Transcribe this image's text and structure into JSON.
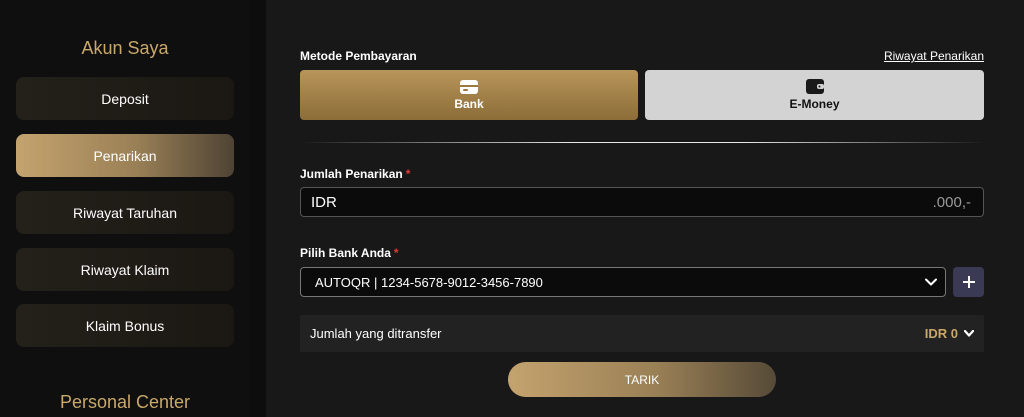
{
  "sidebar": {
    "title": "Akun Saya",
    "items": [
      {
        "label": "Deposit"
      },
      {
        "label": "Penarikan"
      },
      {
        "label": "Riwayat Taruhan"
      },
      {
        "label": "Riwayat Klaim"
      },
      {
        "label": "Klaim Bonus"
      }
    ],
    "section2_title": "Personal Center"
  },
  "form": {
    "method_label": "Metode Pembayaran",
    "history_link": "Riwayat Penarikan",
    "methods": [
      {
        "label": "Bank",
        "icon": "bank-card-icon"
      },
      {
        "label": "E-Money",
        "icon": "wallet-icon"
      }
    ],
    "amount_label": "Jumlah Penarikan",
    "required_mark": "*",
    "amount_currency": "IDR",
    "amount_suffix": ".000,-",
    "bank_label": "Pilih Bank Anda",
    "bank_selected": "AUTOQR | 1234-5678-9012-3456-7890",
    "transfer_label": "Jumlah yang ditransfer",
    "transfer_value": "IDR 0",
    "submit_label": "TARIK"
  },
  "colors": {
    "accent_gold": "#c9a86a",
    "required_red": "#e53935"
  }
}
